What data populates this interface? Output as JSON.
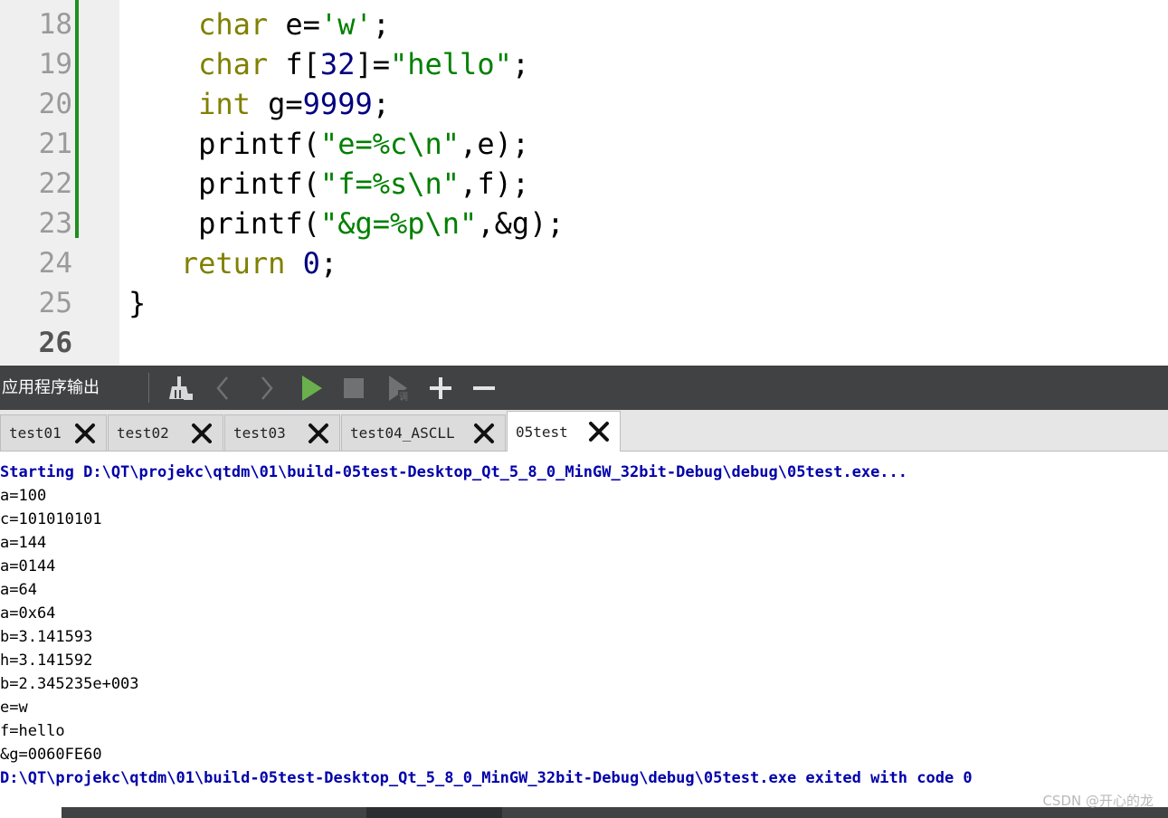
{
  "editor": {
    "lines": [
      {
        "num": "18",
        "indent": "    ",
        "parts": [
          {
            "t": "char",
            "c": "kw"
          },
          {
            "t": " e=",
            "c": "pl"
          },
          {
            "t": "'w'",
            "c": "str"
          },
          {
            "t": ";",
            "c": "pl"
          }
        ]
      },
      {
        "num": "19",
        "indent": "    ",
        "parts": [
          {
            "t": "char",
            "c": "kw"
          },
          {
            "t": " f[",
            "c": "pl"
          },
          {
            "t": "32",
            "c": "num"
          },
          {
            "t": "]=",
            "c": "pl"
          },
          {
            "t": "\"hello\"",
            "c": "str"
          },
          {
            "t": ";",
            "c": "pl"
          }
        ]
      },
      {
        "num": "20",
        "indent": "    ",
        "parts": [
          {
            "t": "int",
            "c": "kw"
          },
          {
            "t": " g=",
            "c": "pl"
          },
          {
            "t": "9999",
            "c": "num"
          },
          {
            "t": ";",
            "c": "pl"
          }
        ]
      },
      {
        "num": "21",
        "indent": "    ",
        "parts": [
          {
            "t": "printf(",
            "c": "pl"
          },
          {
            "t": "\"e=%c\\n\"",
            "c": "str"
          },
          {
            "t": ",e);",
            "c": "pl"
          }
        ]
      },
      {
        "num": "22",
        "indent": "    ",
        "parts": [
          {
            "t": "printf(",
            "c": "pl"
          },
          {
            "t": "\"f=%s\\n\"",
            "c": "str"
          },
          {
            "t": ",f);",
            "c": "pl"
          }
        ]
      },
      {
        "num": "23",
        "indent": "    ",
        "parts": [
          {
            "t": "printf(",
            "c": "pl"
          },
          {
            "t": "\"&g=%p\\n\"",
            "c": "str"
          },
          {
            "t": ",&g);",
            "c": "pl"
          }
        ]
      },
      {
        "num": "24",
        "indent": "   ",
        "parts": [
          {
            "t": "return",
            "c": "kw"
          },
          {
            "t": " ",
            "c": "pl"
          },
          {
            "t": "0",
            "c": "num"
          },
          {
            "t": ";",
            "c": "pl"
          }
        ]
      },
      {
        "num": "25",
        "indent": "",
        "parts": [
          {
            "t": "}",
            "c": "pl"
          }
        ]
      },
      {
        "num": "26",
        "indent": "",
        "parts": []
      }
    ],
    "current_line": "26",
    "changed_lines": [
      "18",
      "19",
      "20",
      "21",
      "22",
      "23"
    ],
    "colors": {
      "keyword": "#808000",
      "string": "#008000",
      "number": "#000080",
      "change_bar": "#1f8f1f"
    }
  },
  "output_pane": {
    "title": "应用程序输出",
    "toolbar": [
      {
        "name": "clear-output-icon"
      },
      {
        "name": "previous-item-icon"
      },
      {
        "name": "next-item-icon"
      },
      {
        "name": "run-icon"
      },
      {
        "name": "stop-icon"
      },
      {
        "name": "attach-debugger-icon"
      },
      {
        "name": "zoom-in-icon"
      },
      {
        "name": "zoom-out-icon"
      }
    ],
    "tabs": [
      {
        "label": "test01",
        "active": false
      },
      {
        "label": "test02",
        "active": false
      },
      {
        "label": "test03",
        "active": false
      },
      {
        "label": "test04_ASCLL",
        "active": false
      },
      {
        "label": "05test",
        "active": true
      }
    ],
    "lines": [
      {
        "text": "Starting D:\\QT\\projekc\\qtdm\\01\\build-05test-Desktop_Qt_5_8_0_MinGW_32bit-Debug\\debug\\05test.exe...",
        "kind": "sys"
      },
      {
        "text": "a=100",
        "kind": "out"
      },
      {
        "text": "c=101010101",
        "kind": "out"
      },
      {
        "text": "a=144",
        "kind": "out"
      },
      {
        "text": "a=0144",
        "kind": "out"
      },
      {
        "text": "a=64",
        "kind": "out"
      },
      {
        "text": "a=0x64",
        "kind": "out"
      },
      {
        "text": "b=3.141593",
        "kind": "out"
      },
      {
        "text": "h=3.141592",
        "kind": "out"
      },
      {
        "text": "b=2.345235e+003",
        "kind": "out"
      },
      {
        "text": "e=w",
        "kind": "out"
      },
      {
        "text": "f=hello",
        "kind": "out"
      },
      {
        "text": "&g=0060FE60",
        "kind": "out"
      },
      {
        "text": "D:\\QT\\projekc\\qtdm\\01\\build-05test-Desktop_Qt_5_8_0_MinGW_32bit-Debug\\debug\\05test.exe exited with code 0",
        "kind": "sys"
      }
    ],
    "colors": {
      "toolbar_bg": "#404244",
      "sys_text": "#0000aa",
      "run_icon": "#6ab04c"
    }
  },
  "watermark": "CSDN @开心的龙"
}
